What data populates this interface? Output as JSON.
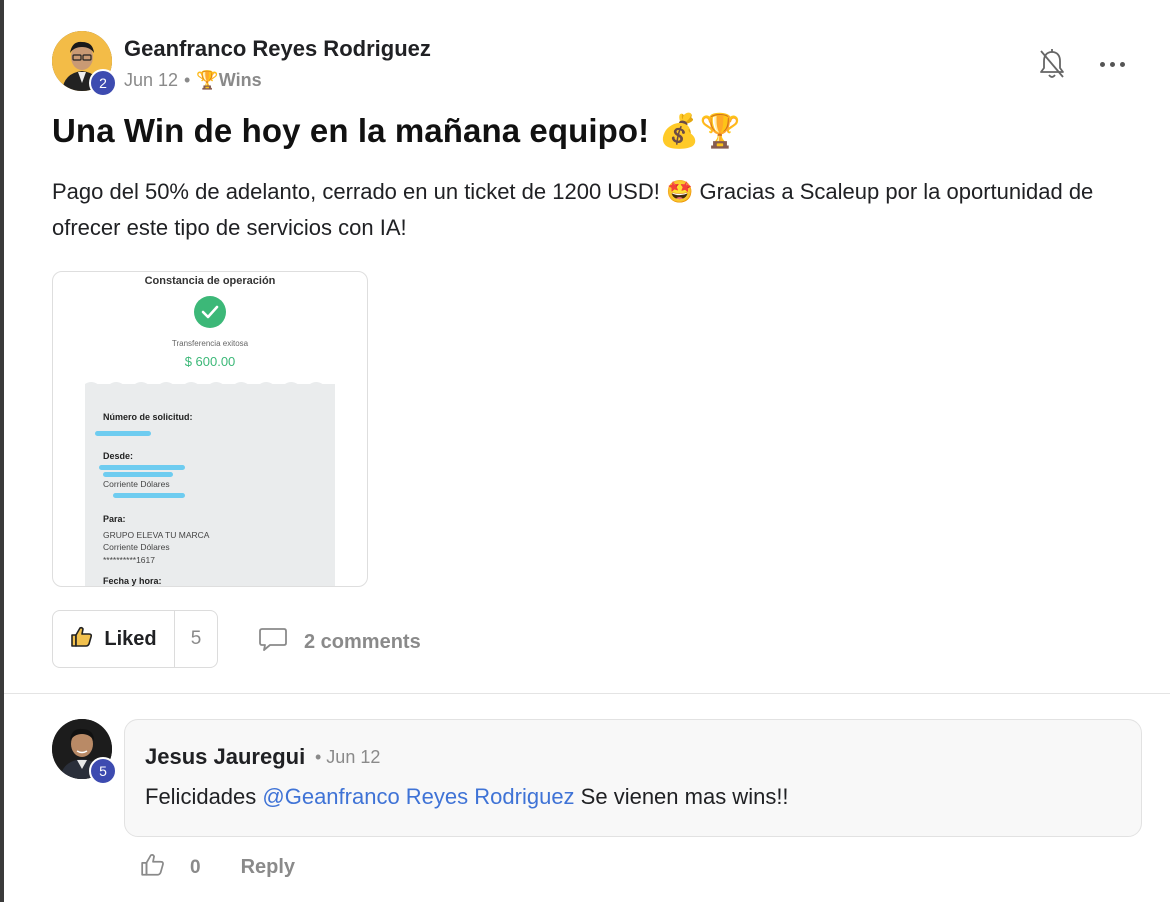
{
  "post": {
    "author": "Geanfranco Reyes Rodriguez",
    "author_level": "2",
    "date": "Jun 12",
    "separator": "•",
    "category_emoji": "🏆",
    "category": "Wins",
    "title": "Una Win de hoy en la mañana equipo! 💰🏆",
    "body": "Pago del 50% de adelanto, cerrado en un ticket de 1200 USD! 🤩 Gracias a Scaleup por la oportunidad de ofrecer este tipo de servicios con IA!"
  },
  "receipt": {
    "title": "Constancia de operación",
    "status": "Transferencia exitosa",
    "amount": "$ 600.00",
    "request_label": "Número de solicitud:",
    "from_label": "Desde:",
    "from_account_type": "Corriente Dólares",
    "to_label": "Para:",
    "to_name": "GRUPO ELEVA TU MARCA",
    "to_account_type": "Corriente Dólares",
    "to_account_number": "**********1617",
    "date_label": "Fecha y hora:"
  },
  "actions": {
    "like_label": "Liked",
    "like_count": "5",
    "comments_label": "2 comments"
  },
  "comment": {
    "author": "Jesus Jauregui",
    "author_level": "5",
    "time": "• Jun 12",
    "text_prefix": "Felicidades ",
    "mention": "@Geanfranco Reyes Rodriguez",
    "text_suffix": " Se vienen mas wins!!",
    "like_count": "0",
    "reply_label": "Reply"
  },
  "colors": {
    "level_badge": "#3d4bb0",
    "mention": "#3f73d6",
    "success": "#3cb878",
    "muted": "#8a8a8a"
  },
  "icons": [
    "bell-off-icon",
    "more-options-icon",
    "thumbs-up-icon",
    "comment-icon",
    "check-icon"
  ]
}
